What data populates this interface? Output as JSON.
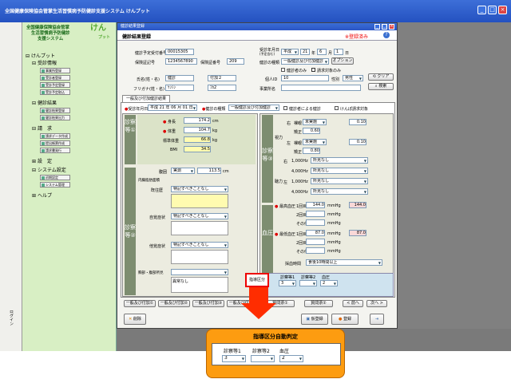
{
  "app_title": "全国健康保険協会管掌生活習慣病予防健診支援システム けんプット",
  "sidebar": {
    "logo_line1": "全国健康保険協会管掌",
    "logo_line2": "生活習慣病予防健診",
    "logo_line3": "支援システム",
    "logo_brand": "けん",
    "logo_brand2": "プット",
    "root": "けんプット",
    "g1": "受診情報",
    "g1_items": [
      "事業所登録",
      "受診者登録",
      "受診予定登録",
      "受診予定取込"
    ],
    "g2": "健診結果",
    "g2_items": [
      "健診結果登録",
      "健診結果出力"
    ],
    "g3": "請　求",
    "g3_items": [
      "請求データ作成",
      "提出帳票作成",
      "請求書発行"
    ],
    "g4": "設　定",
    "g5": "システム設定",
    "g5_items": [
      "初期設定",
      "システム管理"
    ],
    "g6": "ヘルプ"
  },
  "outer_left_text": "ログイン",
  "window": {
    "title": "健診結果登録",
    "header": "健診結果登録",
    "status": "※登録済み"
  },
  "form": {
    "l_yoyaku": "健診予定受付番号",
    "v_yoyaku": "00015305",
    "l_kigo": "保険証記号",
    "v_kigo": "1234567890",
    "l_bango": "保険証番号",
    "v_bango": "209",
    "l_date": "受診年月日",
    "l_date2": "(予定含む)",
    "v_era": "平成",
    "v_year": "21",
    "u_year": "年",
    "v_month": "6",
    "u_month": "月",
    "v_day": "1",
    "u_day": "日",
    "l_kind": "健診の種類",
    "v_kind": "一般健診及び付加健診",
    "btn_option": "オプション",
    "chk1": "健診者のみ",
    "chk2": "請求対象のみ",
    "l_name": "氏名(姓・名)",
    "v_name1": "健診",
    "v_name2": "付加２",
    "l_kana": "フリガナ(姓・名)",
    "v_kana1": "ｹﾝｼﾝ",
    "v_kana2": "ﾌｶ2",
    "l_kojin": "個人ID",
    "v_kojin": "10",
    "l_sex": "性別",
    "v_sex": "男性",
    "l_jigyo": "事業所名",
    "btn_clear": "クリア",
    "btn_search": "検索",
    "tab": "一般及び付加健診結果",
    "l_date3": "受診年月日",
    "v_date3": "平成 21 年 06 月 01 日",
    "l_kind2": "健診の種類",
    "v_kind2": "一般健診及び付加健診",
    "chk3": "健診者による健診",
    "chk4": "けんぽ請求対象"
  },
  "left_panel": {
    "vlabel1": "診察等①",
    "vlabel2": "診察等②",
    "l_height": "身長",
    "v_height": "174.2",
    "u_height": "cm",
    "l_weight": "体重",
    "v_weight": "104.7",
    "u_weight": "kg",
    "l_std": "標準体重",
    "v_std": "66.8",
    "u_std": "kg",
    "l_bmi": "BMI",
    "v_bmi": "34.5",
    "l_waist": "腹囲",
    "v_waist_sel": "実測",
    "v_waist": "113.5",
    "u_waist": "cm",
    "l_naifuku": "内臓脂肪面積",
    "l_kiou": "既往歴",
    "v_kiou": "特記すべきことなし",
    "l_jikaku": "自覚症状",
    "v_jikaku": "特記すべきことなし",
    "l_takaku": "他覚症状",
    "v_takaku": "特記すべきことなし",
    "l_kyobu": "胸部・腹部所見",
    "v_kyobu": "異常なし"
  },
  "right_panel": {
    "vlabel1": "診察等③",
    "vlabel2": "血圧",
    "l_sight": "視力",
    "l_r": "右",
    "l_l": "左",
    "l_naked": "裸眼",
    "l_kyosei": "矯正",
    "v_r_sel": "未実施",
    "v_r_naked": "0.10",
    "v_r_kyosei": "0.60",
    "v_l_sel": "未実施",
    "v_l_naked": "0.10",
    "v_l_kyosei": "0.80",
    "l_hearing": "聴力",
    "hear_rows": [
      {
        "side": "右",
        "hz": "1,000Hz",
        "val": "所見なし"
      },
      {
        "side": "",
        "hz": "4,000Hz",
        "val": "所見なし"
      },
      {
        "side": "左",
        "hz": "1,000Hz",
        "val": "所見なし"
      },
      {
        "side": "",
        "hz": "4,000Hz",
        "val": "所見なし"
      }
    ],
    "l_max": "最高血圧",
    "l_min": "最低血圧",
    "l_1": "1回目",
    "l_2": "2回目",
    "l_o": "その他",
    "v_max1": "144.0",
    "v_max_avg": "144.0",
    "v_min1": "87.0",
    "v_min_avg": "87.0",
    "u_bp": "mmHg",
    "l_meal": "採血時間",
    "v_meal": "食後10時間以上"
  },
  "shidou": {
    "label": "指導区分",
    "h1": "診察等1",
    "h2": "診察等2",
    "h3": "血圧",
    "v1": "3",
    "v2": "",
    "v3": "2"
  },
  "bottom_buttons": [
    "一般及び付加①",
    "一般及び付加②",
    "一般及び付加③",
    "一般及び付加④",
    "質問票①",
    "質問票②",
    "< 前へ",
    "次へ >"
  ],
  "footer": {
    "delete": "削除",
    "temp": "仮登録",
    "save": "登録"
  },
  "callout": {
    "title": "指導区分自動判定",
    "h1": "診察等1",
    "h2": "診察等2",
    "h3": "血圧",
    "v1": "3",
    "v2": "",
    "v3": "2"
  }
}
